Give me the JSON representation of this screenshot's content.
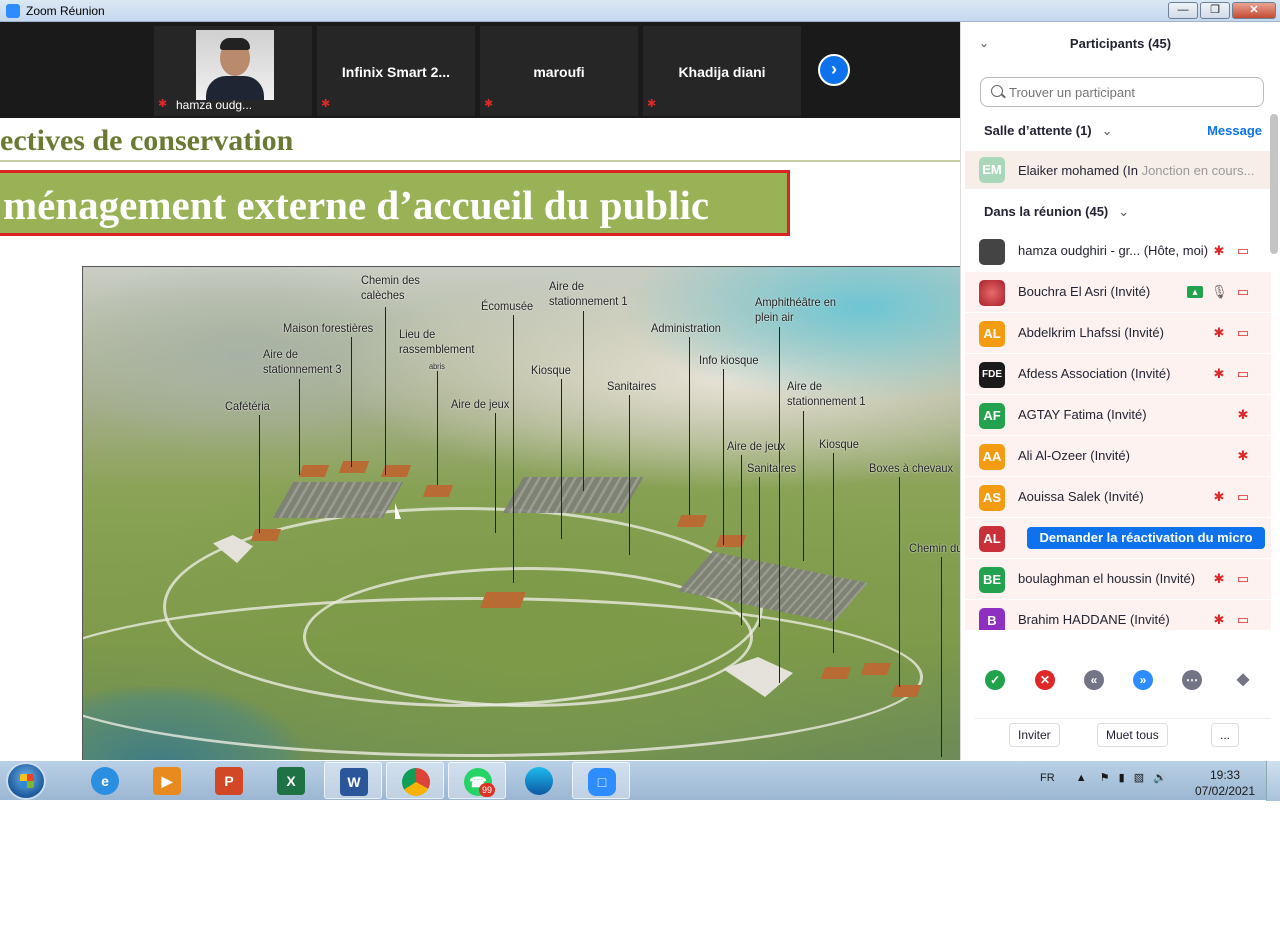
{
  "window": {
    "title": "Zoom Réunion"
  },
  "video_strip": {
    "tiles": [
      {
        "label": "hamza oudg..."
      },
      {
        "name": "Infinix Smart  2..."
      },
      {
        "name": "maroufi"
      },
      {
        "name": "Khadija diani"
      }
    ]
  },
  "slide": {
    "heading": "ectives de conservation",
    "banner": "ménagement externe d’accueil du public",
    "plan_labels": {
      "chemin_caleches": "Chemin des\ncalèches",
      "maison_forestiere": "Maison forestières",
      "aire_stationnement3": "Aire de\nstationnement 3",
      "lieu_rassemblement": "Lieu de\nrassemblement",
      "abris": "abris",
      "ecomusee": "Écomusée",
      "aire_stationnement1_top": "Aire de\nstationnement 1",
      "administration": "Administration",
      "amphitheatre": "Amphithéâtre en\nplein air",
      "kiosque1": "Kiosque",
      "sanitaires1": "Sanitaires",
      "info_kiosque": "Info kiosque",
      "cafeteria": "Cafétéria",
      "aire_jeux1": "Aire de jeux",
      "aire_stationnement1_right": "Aire de\nstationnement 1",
      "aire_jeux2": "Aire de jeux",
      "kiosque2": "Kiosque",
      "sanitaires2": "Sanitaires",
      "boxes": "Boxes à chevaux",
      "chemin_du": "Chemin du"
    }
  },
  "panel": {
    "title": "Participants (45)",
    "search_placeholder": "Trouver un participant",
    "waiting_heading": "Salle d’attente (1)",
    "message_link": "Message",
    "waiting": {
      "initials": "EM",
      "name": "Elaiker mohamed (In",
      "status": "Jonction en cours..."
    },
    "meeting_heading": "Dans la réunion (45)",
    "participants": [
      {
        "initials": "",
        "name": "hamza oudghiri - gr... (Hôte, moi)",
        "color": "#444444"
      },
      {
        "initials": "",
        "name": "Bouchra El Asri (Invité)",
        "color": "#c8313a"
      },
      {
        "initials": "AL",
        "name": "Abdelkrim Lhafssi (Invité)",
        "color": "#f39c12"
      },
      {
        "initials": "FDE",
        "name": "Afdess Association (Invité)",
        "color": "#1a1a1a"
      },
      {
        "initials": "AF",
        "name": "AGTAY Fatima (Invité)",
        "color": "#23a24d"
      },
      {
        "initials": "AA",
        "name": "Ali Al-Ozeer (Invité)",
        "color": "#f39c12"
      },
      {
        "initials": "AS",
        "name": "Aouissa Salek (Invité)",
        "color": "#f39c12"
      },
      {
        "initials": "AL",
        "name": "",
        "color": "#c8313a"
      },
      {
        "initials": "BE",
        "name": "boulaghman el houssin (Invité)",
        "color": "#23a24d"
      },
      {
        "initials": "B",
        "name": "Brahim HADDANE (Invité)",
        "color": "#8e2fc0"
      }
    ],
    "request_unmute": "Demander la réactivation du micro",
    "bottom": {
      "invite": "Inviter",
      "mute_all": "Muet tous",
      "more": "..."
    }
  },
  "taskbar": {
    "lang": "FR",
    "time": "19:33",
    "date": "07/02/2021",
    "whatsapp_badge": "99"
  }
}
